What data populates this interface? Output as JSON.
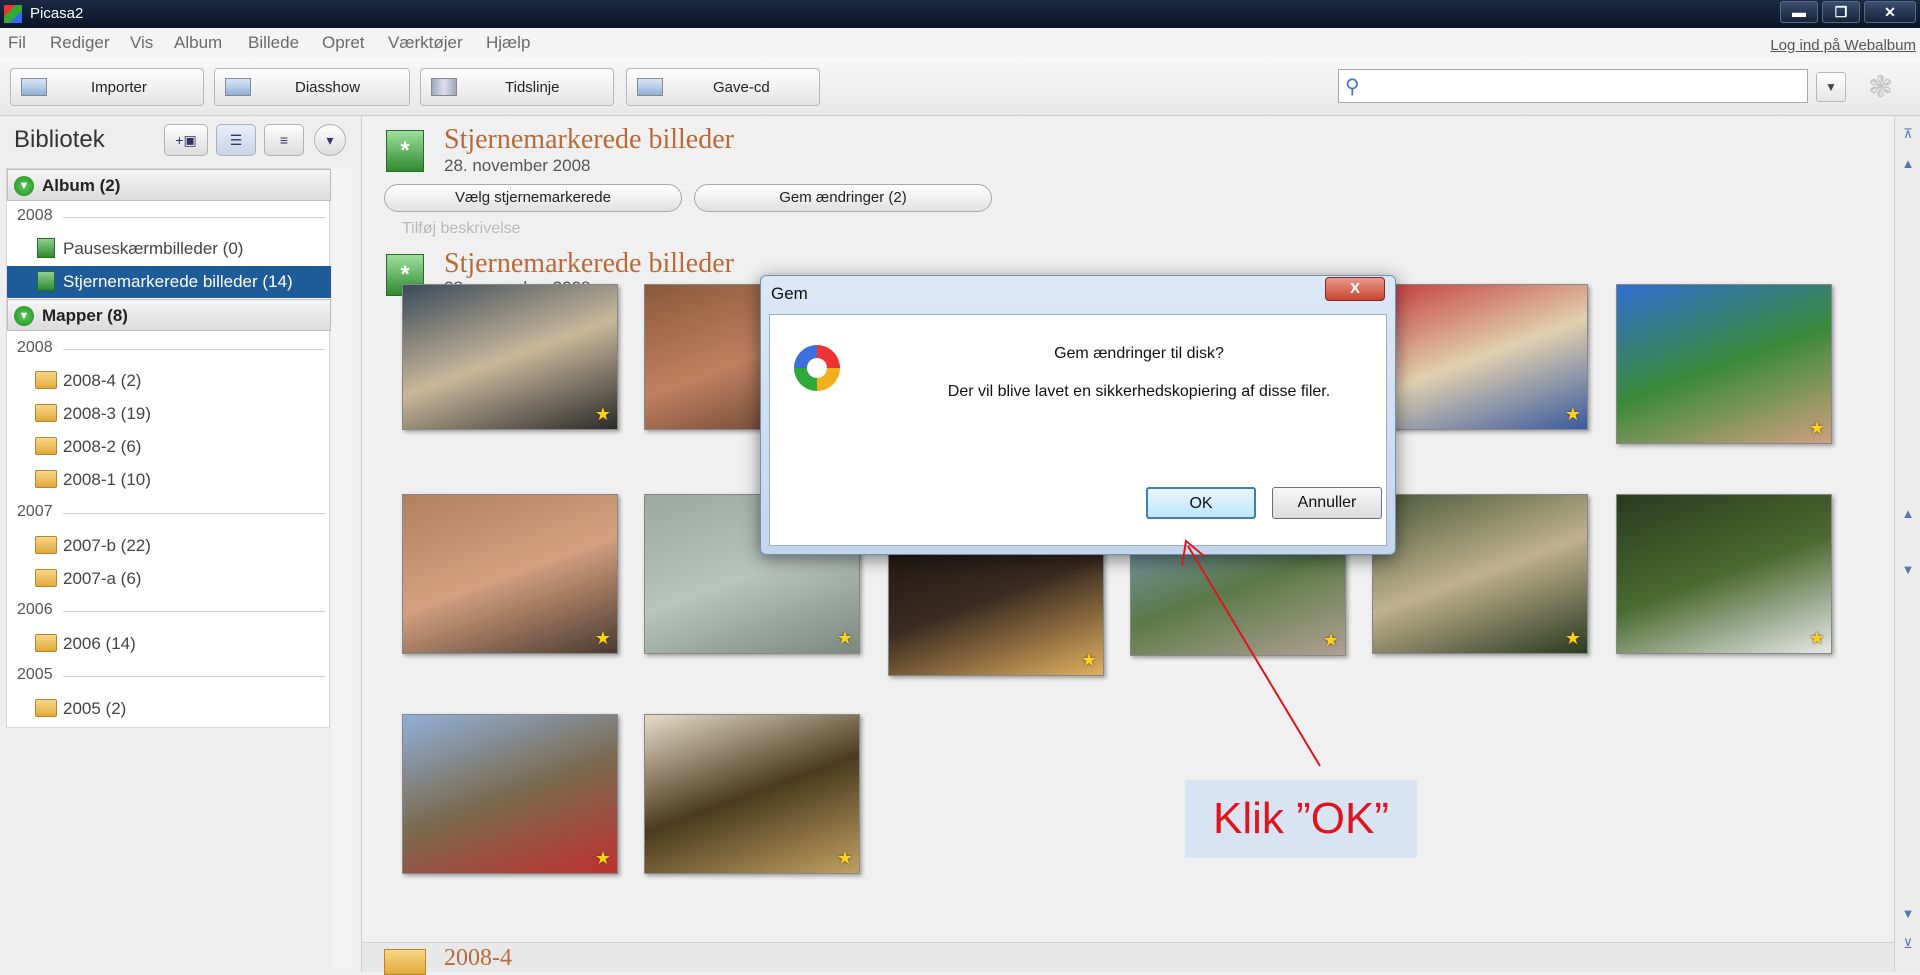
{
  "window": {
    "title": "Picasa2",
    "buttons": {
      "minimize": "▬",
      "restore": "❐",
      "close": "✕"
    }
  },
  "menubar": {
    "items": [
      "Fil",
      "Rediger",
      "Vis",
      "Album",
      "Billede",
      "Opret",
      "Værktøjer",
      "Hjælp"
    ],
    "login_link": "Log ind på Webalbum"
  },
  "toolbar": {
    "buttons": [
      "Importer",
      "Diasshow",
      "Tidslinje",
      "Gave-cd"
    ],
    "search_placeholder": ""
  },
  "sidebar": {
    "heading": "Bibliotek",
    "sections": [
      {
        "label": "Album (2)",
        "groups": [
          {
            "year": "2008",
            "items": [
              "Pauseskærmbilleder (0)",
              "Stjernemarkerede billeder (14)"
            ]
          }
        ]
      },
      {
        "label": "Mapper (8)",
        "groups": [
          {
            "year": "2008",
            "items": [
              "2008-4 (2)",
              "2008-3 (19)",
              "2008-2 (6)",
              "2008-1 (10)"
            ]
          },
          {
            "year": "2007",
            "items": [
              "2007-b (22)",
              "2007-a (6)"
            ]
          },
          {
            "year": "2006",
            "items": [
              "2006 (14)"
            ]
          },
          {
            "year": "2005",
            "items": [
              "2005 (2)"
            ]
          }
        ]
      }
    ],
    "selected_item": "Stjernemarkerede billeder (14)"
  },
  "main": {
    "album_header": {
      "title": "Stjernemarkerede billeder",
      "date": "28. november 2008",
      "buttons": [
        "Vælg stjernemarkerede",
        "Gem ændringer (2)"
      ],
      "description_placeholder": "Tilføj beskrivelse"
    },
    "second_header": {
      "title": "Stjernemarkerede billeder",
      "date": "28. november 2008"
    },
    "folder_footer": "2008-4",
    "photos": [
      {
        "name": "photo-kids-bench",
        "colors": [
          "#3a4a5a",
          "#c9b79a",
          "#2a2a2a"
        ]
      },
      {
        "name": "photo-canyon",
        "colors": [
          "#8a5a3a",
          "#c08060",
          "#5a3a2a"
        ]
      },
      {
        "name": "photo-hidden-1",
        "colors": [
          "#888",
          "#aaa",
          "#777"
        ]
      },
      {
        "name": "photo-hidden-2",
        "colors": [
          "#888",
          "#aaa",
          "#777"
        ]
      },
      {
        "name": "photo-girl-toys",
        "colors": [
          "#c43a3a",
          "#e0d0b0",
          "#3a5aa0"
        ]
      },
      {
        "name": "photo-boy-sky",
        "colors": [
          "#2f6fd0",
          "#3a8a3a",
          "#d0a080"
        ]
      },
      {
        "name": "photo-beach-sunset",
        "colors": [
          "#b08060",
          "#d4a080",
          "#4a3a30"
        ]
      },
      {
        "name": "photo-jellyfish",
        "colors": [
          "#9aa8a0",
          "#b8c4bc",
          "#7a8880"
        ]
      },
      {
        "name": "photo-candles",
        "colors": [
          "#1a1410",
          "#3a2a20",
          "#e0b060"
        ]
      },
      {
        "name": "photo-windmill",
        "colors": [
          "#7a9ac0",
          "#5a7a4a",
          "#b0a090"
        ]
      },
      {
        "name": "photo-grandpa-bench",
        "colors": [
          "#4a5a3a",
          "#c0b090",
          "#2a3a20"
        ]
      },
      {
        "name": "photo-swan",
        "colors": [
          "#2a3a20",
          "#4a6a30",
          "#e8e8e8"
        ]
      },
      {
        "name": "photo-kids-cannon",
        "colors": [
          "#90b0d8",
          "#7a6a50",
          "#c03030"
        ]
      },
      {
        "name": "photo-trumpet",
        "colors": [
          "#e8dcc8",
          "#4a3a20",
          "#c0a060"
        ]
      }
    ]
  },
  "dialog": {
    "title": "Gem",
    "close": "X",
    "question": "Gem ændringer til disk?",
    "detail": "Der vil blive lavet en sikkerhedskopiering af disse filer.",
    "ok": "OK",
    "cancel": "Annuller"
  },
  "annotation": {
    "text": "Klik ”OK”",
    "color": "#e0141e"
  }
}
